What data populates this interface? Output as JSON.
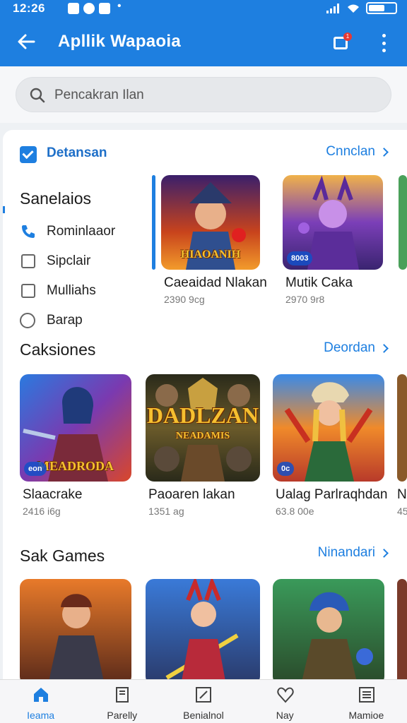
{
  "status_bar": {
    "time": "12:26"
  },
  "app_bar": {
    "title": "Apllik Wapaoia",
    "notification_count": "1"
  },
  "search": {
    "placeholder": "Pencakran Ilan"
  },
  "featured": {
    "title": "Detansan",
    "link": "Cnnclan"
  },
  "filters": {
    "title": "Sanelaios",
    "items": [
      {
        "label": "Rominlaaor",
        "type": "phone"
      },
      {
        "label": "Sipclair",
        "type": "checkbox"
      },
      {
        "label": "Mulliahs",
        "type": "checkbox"
      },
      {
        "label": "Barap",
        "type": "radio"
      }
    ]
  },
  "featured_games": [
    {
      "name": "Caeaidad Nlakan",
      "size": "2390 9cg",
      "overlay": "HIAOANIH"
    },
    {
      "name": "Mutik Caka",
      "size": "2970 9r8",
      "tag": "8003"
    }
  ],
  "categories": {
    "title": "Caksiones",
    "link": "Deordan",
    "items": [
      {
        "name": "Slaacrake",
        "size": "2416 i6g",
        "tag": "eon",
        "overlay": "MEADRODA"
      },
      {
        "name": "Paoaren lakan",
        "size": "1351 ag",
        "overlay": "DADLZAN",
        "overlay2": "NEADAMIS"
      },
      {
        "name": "Ualag Parlraqhdan",
        "size": "63.8 00e",
        "tag": "0c"
      },
      {
        "name": "N",
        "size": "45"
      }
    ]
  },
  "sak_games": {
    "title": "Sak Games",
    "link": "Ninandari",
    "items": [
      {},
      {},
      {}
    ]
  },
  "bottom_nav": [
    {
      "label": "Ieama",
      "icon": "home-icon",
      "active": true
    },
    {
      "label": "Parelly",
      "icon": "book-icon",
      "active": false
    },
    {
      "label": "Benialnol",
      "icon": "edit-icon",
      "active": false
    },
    {
      "label": "Nay",
      "icon": "heart-icon",
      "active": false
    },
    {
      "label": "Mamioe",
      "icon": "menu-icon",
      "active": false
    }
  ],
  "colors": {
    "primary": "#1e7fe0",
    "background": "#eef1f4"
  }
}
